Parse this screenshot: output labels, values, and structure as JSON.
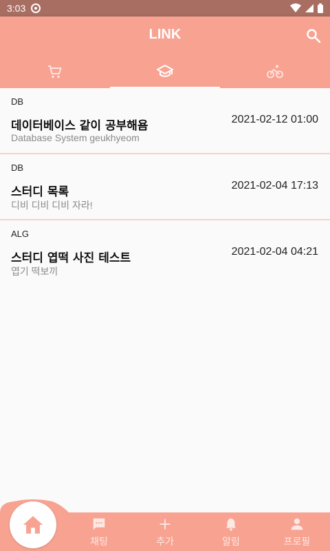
{
  "status": {
    "time": "3:03"
  },
  "app": {
    "title": "LINK"
  },
  "tabs": [
    {
      "icon": "cart-icon"
    },
    {
      "icon": "graduation-cap-icon"
    },
    {
      "icon": "bicycle-icon"
    }
  ],
  "posts": [
    {
      "category": "DB",
      "title": "데이터베이스 같이 공부해욤",
      "date": "2021-02-12 01:00",
      "subtitle": "Database System geukhyeom"
    },
    {
      "category": "DB",
      "title": "스터디 목록",
      "date": "2021-02-04 17:13",
      "subtitle": "디비 디비 디비 자라!"
    },
    {
      "category": "ALG",
      "title": "스터디 엽떡 사진 테스트",
      "date": "2021-02-04 04:21",
      "subtitle": "엽기 떡보끼"
    }
  ],
  "bottom_nav": {
    "home_icon": "home-icon",
    "items": [
      {
        "label": "채팅",
        "icon": "chat-icon"
      },
      {
        "label": "추가",
        "icon": "plus-icon"
      },
      {
        "label": "알림",
        "icon": "bell-icon"
      },
      {
        "label": "프로필",
        "icon": "person-icon"
      }
    ]
  },
  "colors": {
    "primary": "#f8a392",
    "status_bar": "#a86e62",
    "divider": "#f6d2ca",
    "home_icon": "#f8a392"
  }
}
